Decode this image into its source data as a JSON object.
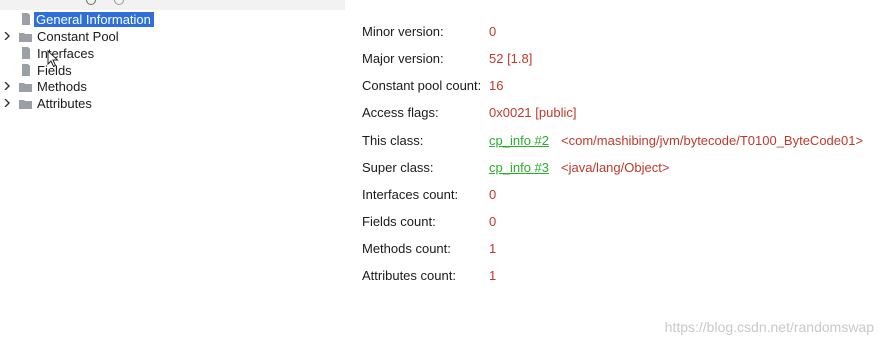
{
  "tree": {
    "items": [
      {
        "label": "General Information",
        "icon": "file-icon",
        "expandable": false,
        "selected": true
      },
      {
        "label": "Constant Pool",
        "icon": "folder-icon",
        "expandable": true,
        "selected": false
      },
      {
        "label": "Interfaces",
        "icon": "file-icon",
        "expandable": false,
        "selected": false
      },
      {
        "label": "Fields",
        "icon": "file-icon",
        "expandable": false,
        "selected": false
      },
      {
        "label": "Methods",
        "icon": "folder-icon",
        "expandable": true,
        "selected": false
      },
      {
        "label": "Attributes",
        "icon": "folder-icon",
        "expandable": true,
        "selected": false
      }
    ]
  },
  "details": {
    "minor_version": {
      "label": "Minor version:",
      "value": "0"
    },
    "major_version": {
      "label": "Major version:",
      "value": "52 [1.8]"
    },
    "constant_pool_count": {
      "label": "Constant pool count:",
      "value": "16"
    },
    "access_flags": {
      "label": "Access flags:",
      "value": "0x0021 [public]"
    },
    "this_class": {
      "label": "This class:",
      "link": "cp_info #2",
      "extra": "<com/mashibing/jvm/bytecode/T0100_ByteCode01>"
    },
    "super_class": {
      "label": "Super class:",
      "link": "cp_info #3",
      "extra": "<java/lang/Object>"
    },
    "interfaces_count": {
      "label": "Interfaces count:",
      "value": "0"
    },
    "fields_count": {
      "label": "Fields count:",
      "value": "0"
    },
    "methods_count": {
      "label": "Methods count:",
      "value": "1"
    },
    "attributes_count": {
      "label": "Attributes count:",
      "value": "1"
    }
  },
  "watermark": "https://blog.csdn.net/randomswap",
  "colors": {
    "selection": "#2f6fdc",
    "value_red": "#c0392b",
    "link_green": "#2bb02b"
  }
}
